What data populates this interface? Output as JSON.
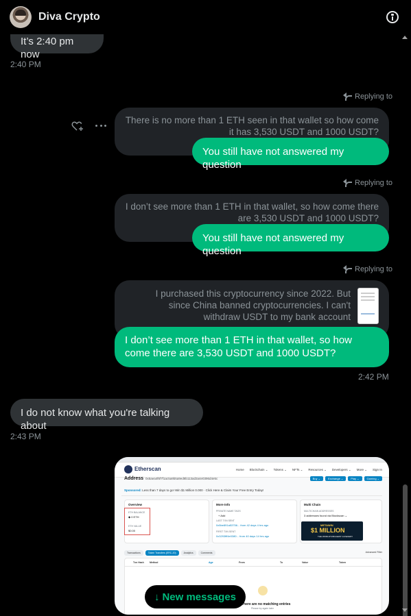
{
  "header": {
    "title": "Diva Crypto"
  },
  "messages": {
    "m1": {
      "text": "It’s 2:40 pm now",
      "time": "2:40 PM"
    },
    "r1": {
      "replying": "Replying to",
      "quote": "There is no more than 1 ETH seen in that wallet so how come it has 3,530 USDT and 1000 USDT?",
      "text": "You still have not answered my question"
    },
    "r2": {
      "replying": "Replying to",
      "quote": "I don’t see more than 1 ETH in that wallet, so how come there are 3,530 USDT and 1000 USDT?",
      "text": "You still have not answered my question"
    },
    "r3": {
      "replying": "Replying to",
      "quote": "I purchased this cryptocurrency since 2022. But since China banned cryptocurrencies. I can't withdraw USDT to my bank account",
      "text": "I don’t see more than 1 ETH in that wallet, so how come there are 3,530 USDT and 1000 USDT?",
      "time": "2:42 PM"
    },
    "m2": {
      "text": "I do not know what you're talking about",
      "time": "2:43 PM"
    }
  },
  "new_messages": {
    "label": "New messages",
    "icon": "arrow-down-icon"
  },
  "screenshot": {
    "brand": "Etherscan",
    "menu": [
      "Home",
      "Blockchain ⌄",
      "Tokens ⌄",
      "NFTs ⌄",
      "Resources ⌄",
      "Developers ⌄",
      "More ⌄",
      "Sign In"
    ],
    "address_label": "Address",
    "address_hash": "0x5aea4f6f7f1ac5a9b5a9ed8b113ad3a4e0396d4e5c",
    "buttons": [
      "Buy ⌄",
      "Exchange ⌄",
      "Play ⌄",
      "Gaming ⌄"
    ],
    "sponsored_label": "Sponsored:",
    "sponsored_text": "Less than 7 days to go! Win $1 Million 0.000 · Click Here & Claim Your Free Entry Today!",
    "overview": {
      "title": "Overview",
      "eth_balance_label": "ETH BALANCE",
      "eth_balance": "◆ 0 ETH",
      "eth_value_label": "ETH VALUE",
      "eth_value": "$0.00"
    },
    "more_info": {
      "title": "More Info",
      "private_tags_label": "PRIVATE NAME TAGS",
      "private_tags": "+ Add",
      "last_txn_label": "LAST TXN SENT",
      "last_txn": "0x5be891a53756... from 42 days 4 hrs ago",
      "first_txn_label": "FIRST TXN SENT",
      "first_txn": "0x3293fff4e0380... from 40 days 14 hrs ago"
    },
    "multichain": {
      "title": "Multi Chain",
      "label": "MULTICHAIN ADDRESSES",
      "value": "3 addresses found via Blockscan ⌄"
    },
    "banner": {
      "brand": "METAWIN",
      "amount": "$1 MILLION",
      "sub": "THE WORLD'S BIGGEST GIVEAWAY"
    },
    "tabs": [
      "Transactions",
      "Token Transfers (ERC-20)",
      "Analytics",
      "Comments"
    ],
    "advanced_filter": "Advanced Filter",
    "table_headers": [
      "Txn Hash",
      "Method",
      "Age",
      "From",
      "To",
      "Value",
      "Token"
    ],
    "empty": "There are no matching entries",
    "empty_sub": "Please try again later"
  }
}
